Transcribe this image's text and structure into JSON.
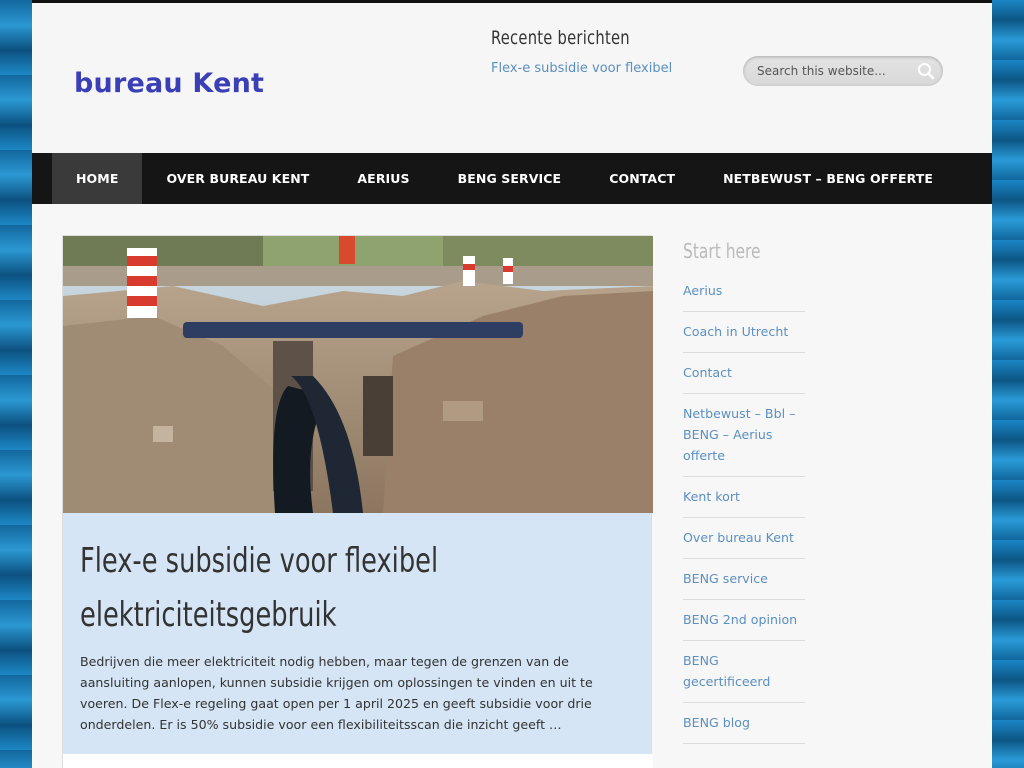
{
  "header": {
    "logo_text": "bureau Kent",
    "recent_title": "Recente berichten",
    "recent_link": "Flex-e subsidie voor flexibel",
    "search_placeholder": "Search this website..."
  },
  "nav": {
    "items": [
      {
        "label": "HOME",
        "active": true
      },
      {
        "label": "OVER BUREAU KENT"
      },
      {
        "label": "AERIUS"
      },
      {
        "label": "BENG SERVICE"
      },
      {
        "label": "CONTACT"
      },
      {
        "label": "NETBEWUST – BENG OFFERTE"
      }
    ]
  },
  "post": {
    "title": "Flex-e subsidie voor flexibel elektriciteitsgebruik",
    "excerpt": "Bedrijven die meer elektriciteit nodig hebben, maar tegen de grenzen van de aansluiting aanlopen, kunnen subsidie krijgen om oplossingen te vinden en uit te voeren. De Flex-e regeling gaat open per 1 april 2025 en geeft subsidie voor drie onderdelen. Er is 50% subsidie voor een flexibiliteitsscan die inzicht geeft …"
  },
  "sidebar": {
    "title": "Start here",
    "items": [
      {
        "label": "Aerius"
      },
      {
        "label": "Coach in Utrecht"
      },
      {
        "label": "Contact"
      },
      {
        "label": "Netbewust – Bbl – BENG – Aerius offerte"
      },
      {
        "label": "Kent kort"
      },
      {
        "label": "Over bureau Kent"
      },
      {
        "label": "BENG service"
      },
      {
        "label": "BENG 2nd opinion"
      },
      {
        "label": "BENG gecertificeerd"
      },
      {
        "label": "BENG blog"
      }
    ]
  },
  "colors": {
    "logo": "#3b3fb6",
    "link": "#5b8fc2",
    "nav_bg": "#151515",
    "nav_active": "#3a3a3a",
    "post_bg": "#d5e5f5"
  },
  "icons": {
    "search": "magnifier-icon"
  }
}
